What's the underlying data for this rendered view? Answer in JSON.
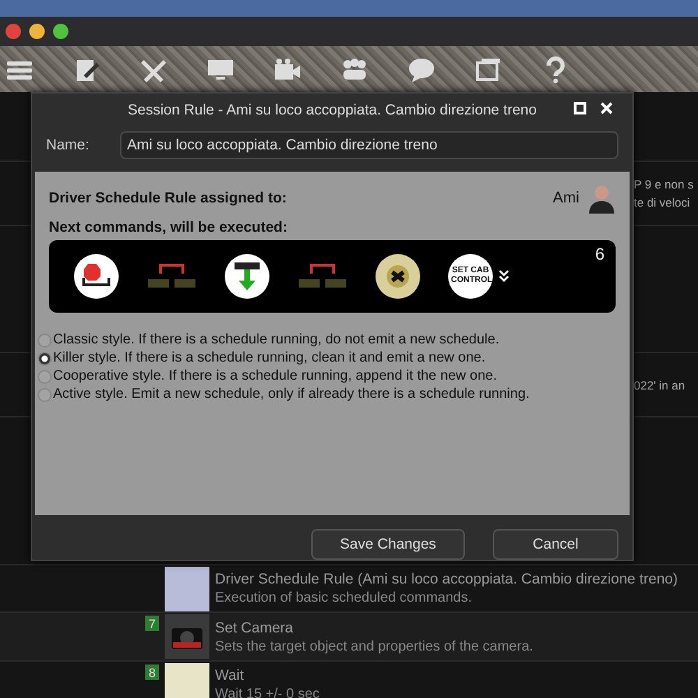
{
  "dialog": {
    "title": "Session Rule - Ami su loco accoppiata. Cambio direzione treno",
    "name_label": "Name:",
    "name_value": "Ami su loco accoppiata. Cambio direzione treno",
    "assigned_label": "Driver Schedule Rule assigned to:",
    "assignee": "Ami",
    "next_label": "Next commands, will be executed:",
    "command_count": "6",
    "commands": [
      {
        "kind": "stop"
      },
      {
        "kind": "coupling"
      },
      {
        "kind": "arrow"
      },
      {
        "kind": "coupling"
      },
      {
        "kind": "knob"
      },
      {
        "kind": "label",
        "label": "SET CAB CONTROL"
      }
    ],
    "options": [
      {
        "label": "Classic style. If there is a schedule running, do not emit a new schedule.",
        "selected": false
      },
      {
        "label": "Killer style. If there is a schedule running, clean it and emit a new one.",
        "selected": true
      },
      {
        "label": "Cooperative style. If there is a schedule running, append it the new one.",
        "selected": false
      },
      {
        "label": "Active style. Emit a new schedule, only if already there is a schedule running.",
        "selected": false
      }
    ],
    "buttons": [
      "Save Changes",
      "Cancel"
    ]
  },
  "background_texts": [
    [
      "P 9 e non s",
      "te di veloci"
    ],
    [
      "022' in an"
    ]
  ],
  "rows": [
    {
      "number": "",
      "kind": "schedule",
      "title": "Driver Schedule Rule (Ami su loco accoppiata. Cambio direzione treno)",
      "description": "Execution of basic scheduled commands."
    },
    {
      "number": "7",
      "kind": "camera",
      "title": "Set Camera",
      "description": "Sets the target object and properties of the camera."
    },
    {
      "number": "8",
      "kind": "wait",
      "title": "Wait",
      "description": "Wait 15 +/- 0 sec"
    }
  ]
}
